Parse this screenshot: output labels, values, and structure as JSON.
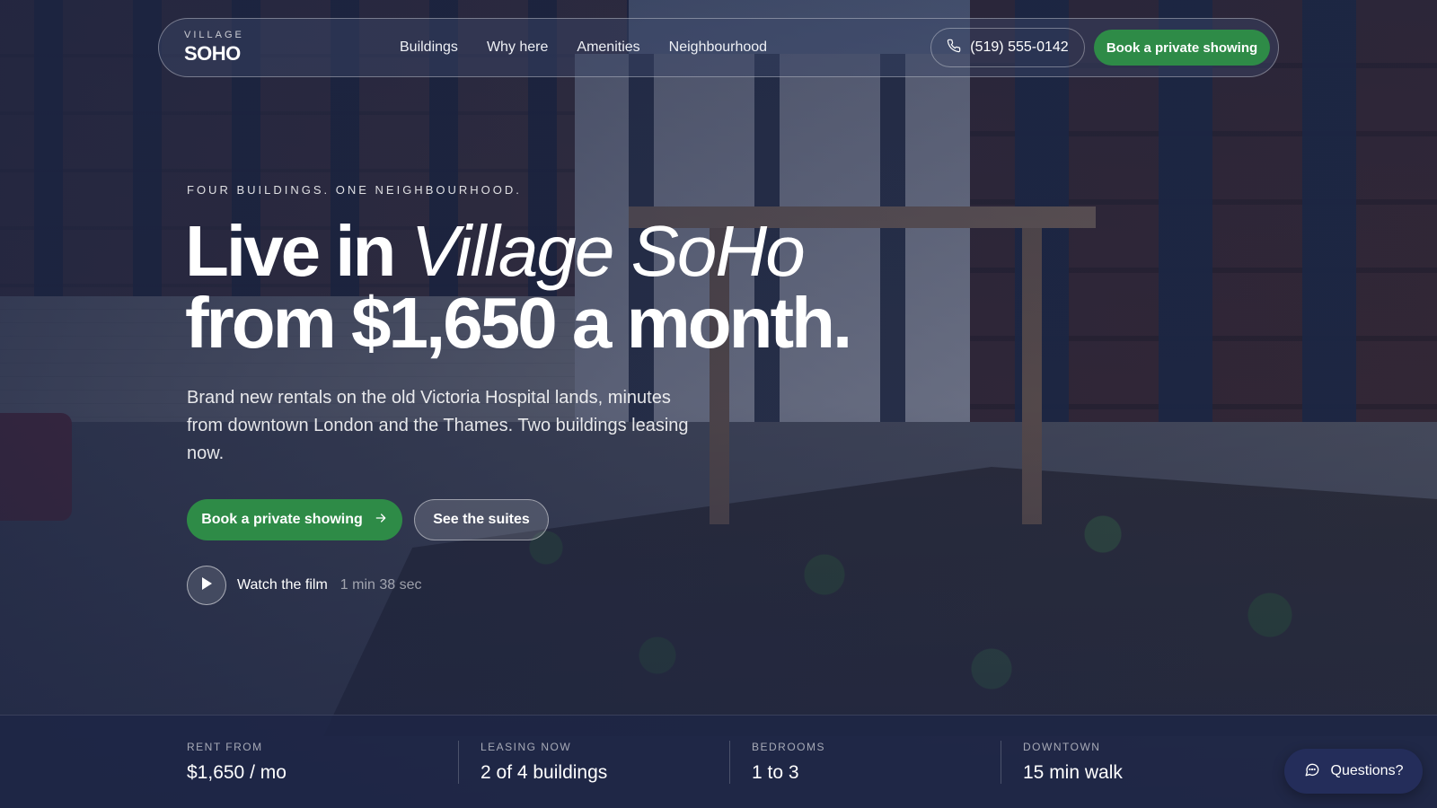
{
  "brand": {
    "top": "VILLAGE",
    "main": "SOHO"
  },
  "nav": {
    "links": [
      "Buildings",
      "Why here",
      "Amenities",
      "Neighbourhood"
    ],
    "phone": "(519) 555-0142",
    "cta": "Book a private showing"
  },
  "hero": {
    "eyebrow": "FOUR BUILDINGS. ONE NEIGHBOURHOOD.",
    "headline_a": "Live in ",
    "headline_italic": "Village SoHo",
    "headline_b": "from $1,650 a month.",
    "lede": "Brand new rentals on the old Victoria Hospital lands, minutes from downtown London and the Thames. Two buildings leasing now.",
    "primary_cta": "Book a private showing",
    "secondary_cta": "See the suites",
    "film_label": "Watch the film",
    "film_duration": "1 min 38 sec"
  },
  "stats": [
    {
      "label": "RENT FROM",
      "value": "$1,650 / mo"
    },
    {
      "label": "LEASING NOW",
      "value": "2 of 4 buildings"
    },
    {
      "label": "BEDROOMS",
      "value": "1 to 3"
    },
    {
      "label": "DOWNTOWN",
      "value": "15 min walk"
    }
  ],
  "chat": {
    "label": "Questions?"
  },
  "icons": {
    "phone": "phone-icon",
    "arrow": "arrow-right-icon",
    "play": "play-icon",
    "chat": "chat-bubble-icon"
  },
  "colors": {
    "accent": "#2e8b47",
    "overlay": "#1c2442",
    "chat_bg": "#242d5a"
  }
}
